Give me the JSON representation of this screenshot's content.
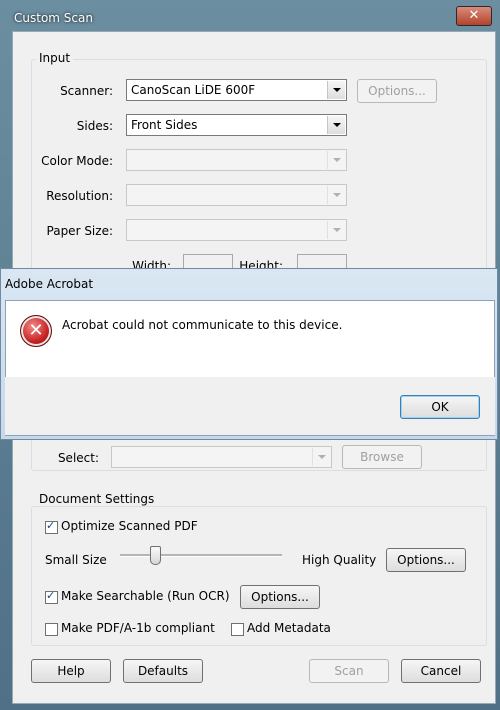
{
  "window": {
    "title": "Custom Scan",
    "close_glyph": "✕"
  },
  "input": {
    "title": "Input",
    "scanner_label": "Scanner:",
    "scanner_value": "CanoScan LiDE 600F",
    "options_label": "Options...",
    "sides_label": "Sides:",
    "sides_value": "Front Sides",
    "color_mode_label": "Color Mode:",
    "resolution_label": "Resolution:",
    "paper_size_label": "Paper Size:",
    "width_label": "Width:",
    "height_label": "Height:"
  },
  "output": {
    "select_label": "Select:",
    "browse_label": "Browse"
  },
  "document_settings": {
    "title": "Document Settings",
    "optimize_label": "Optimize Scanned PDF",
    "optimize_checked": true,
    "small_size_label": "Small Size",
    "high_quality_label": "High Quality",
    "slider_position": 0.22,
    "options_label": "Options...",
    "searchable_label": "Make Searchable (Run OCR)",
    "searchable_checked": true,
    "searchable_options_label": "Options...",
    "pdfa_label": "Make PDF/A-1b compliant",
    "pdfa_checked": false,
    "metadata_label": "Add Metadata",
    "metadata_checked": false
  },
  "footer": {
    "help_label": "Help",
    "defaults_label": "Defaults",
    "scan_label": "Scan",
    "cancel_label": "Cancel"
  },
  "alert": {
    "title": "Adobe Acrobat",
    "message": "Acrobat could not communicate to this device.",
    "ok_label": "OK",
    "icon": "error-icon",
    "icon_glyph": "✕"
  },
  "colors": {
    "title_bar": "#5a7a8a",
    "alert_title": "#c7d8ea",
    "error_red": "#c51d1d"
  }
}
